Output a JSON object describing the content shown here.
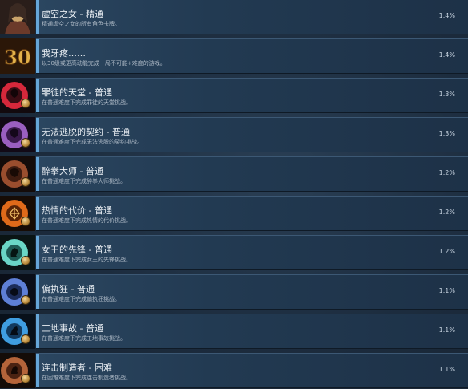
{
  "achievements": [
    {
      "title": "虚空之女 - 精通",
      "desc": "精通虚空之女的所有角色卡牌。",
      "pct": "1.4%",
      "icon": "portrait-icon",
      "color": "#c9a36a"
    },
    {
      "title": "我牙疼……",
      "desc": "以30级或更高动能完成一局不可能+难度的游戏。",
      "pct": "1.4%",
      "icon": "number-30-icon",
      "color": "#d8a13a",
      "icon_text": "30"
    },
    {
      "title": "罪徒的天堂 - 普通",
      "desc": "在普通难度下完成罪徒的天堂挑战。",
      "pct": "1.3%",
      "icon": "red-disc-icon",
      "color": "#d6283b"
    },
    {
      "title": "无法逃脱的契约 - 普通",
      "desc": "在普通难度下完成无法逃脱的契约挑战。",
      "pct": "1.3%",
      "icon": "purple-disc-icon",
      "color": "#9a5fc0"
    },
    {
      "title": "醉拳大师 - 普通",
      "desc": "在普通难度下完成醉拳大师挑战。",
      "pct": "1.2%",
      "icon": "brown-disc-icon",
      "color": "#9a4e2e"
    },
    {
      "title": "热情的代价 - 普通",
      "desc": "在普通难度下完成热情的代价挑战。",
      "pct": "1.2%",
      "icon": "orange-disc-icon",
      "color": "#e06a1a"
    },
    {
      "title": "女王的先锋 - 普通",
      "desc": "在普通难度下完成女王的先锋挑战。",
      "pct": "1.2%",
      "icon": "teal-disc-icon",
      "color": "#6ad6c6"
    },
    {
      "title": "偏执狂 - 普通",
      "desc": "在普通难度下完成偏执狂挑战。",
      "pct": "1.1%",
      "icon": "blue-disc-icon",
      "color": "#5e7fd6"
    },
    {
      "title": "工地事故 - 普通",
      "desc": "在普通难度下完成工地事故挑战。",
      "pct": "1.1%",
      "icon": "sky-disc-icon",
      "color": "#3f9de0"
    },
    {
      "title": "连击制造者 - 困难",
      "desc": "在困难难度下完成连击制造者挑战。",
      "pct": "1.1%",
      "icon": "copper-disc-icon",
      "color": "#b4643a"
    }
  ]
}
